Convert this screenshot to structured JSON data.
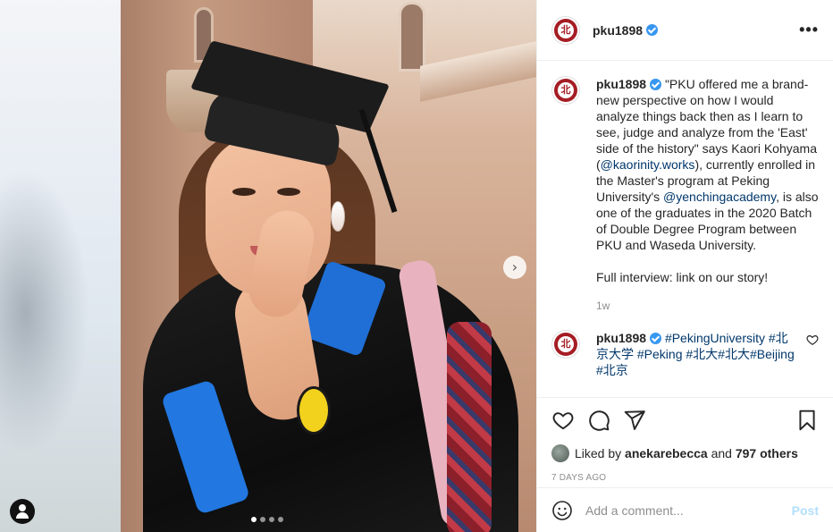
{
  "post": {
    "username": "pku1898",
    "verified": true,
    "caption": {
      "intro": "\"PKU offered me a brand-new perspective on how I would analyze things back then as I learn to see, judge and analyze from the 'East' side of the history\" says Kaori Kohyama (",
      "mention1": "@kaorinity.works",
      "mid": "), currently enrolled in the Master's program at Peking University's ",
      "mention2": "@yenchingacademy",
      "outro": ", is also one of the graduates in the 2020 Batch of Double Degree Program between PKU and Waseda University.",
      "footer": "Full interview: link on our story!",
      "time": "1w"
    },
    "comment": {
      "username": "pku1898",
      "hashtags": "#PekingUniversity #北京大学 #Peking #北大#北大#Beijing #北京"
    },
    "likes": {
      "prefix": "Liked by",
      "liker": "anekarebecca",
      "conj": "and",
      "others": "797 others"
    },
    "date": "7 DAYS AGO",
    "add_comment_placeholder": "Add a comment...",
    "post_button": "Post"
  },
  "carousel": {
    "count": 4,
    "active_index": 0
  },
  "icons": {
    "next": "chevron-right-icon",
    "tag": "user-tag-icon",
    "more": "more-options-icon",
    "like": "heart-icon",
    "comment": "comment-icon",
    "share": "share-icon",
    "save": "bookmark-icon",
    "emoji": "emoji-icon"
  },
  "colors": {
    "brand_red": "#a51d24",
    "link": "#00376b",
    "verified": "#3897f0",
    "post_button_disabled": "#b2dffc",
    "muted": "#8e8e8e"
  }
}
